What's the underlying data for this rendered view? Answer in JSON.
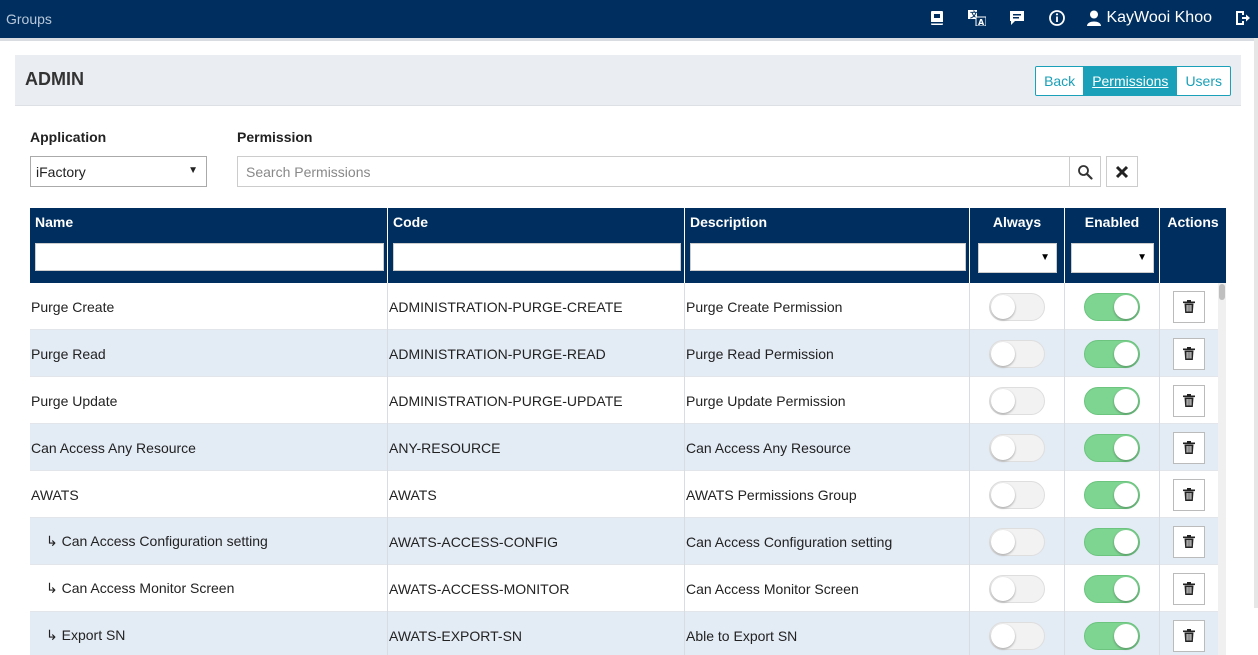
{
  "header": {
    "brand": "Groups",
    "user_name": "KayWooi Khoo",
    "icons": [
      "book-icon",
      "translate-icon",
      "message-icon",
      "info-icon",
      "user-icon",
      "logout-icon"
    ]
  },
  "panel": {
    "title": "ADMIN",
    "buttons": [
      {
        "label": "Back",
        "active": false
      },
      {
        "label": "Permissions",
        "active": true
      },
      {
        "label": "Users",
        "active": false
      }
    ]
  },
  "filters": {
    "application_label": "Application",
    "application_value": "iFactory",
    "permission_label": "Permission",
    "search_placeholder": "Search Permissions"
  },
  "table": {
    "columns": [
      "Name",
      "Code",
      "Description",
      "Always",
      "Enabled",
      "Actions"
    ],
    "rows": [
      {
        "name": "Purge Create",
        "code": "ADMINISTRATION-PURGE-CREATE",
        "description": "Purge Create Permission",
        "always": false,
        "enabled": true,
        "child": false
      },
      {
        "name": "Purge Read",
        "code": "ADMINISTRATION-PURGE-READ",
        "description": "Purge Read Permission",
        "always": false,
        "enabled": true,
        "child": false
      },
      {
        "name": "Purge Update",
        "code": "ADMINISTRATION-PURGE-UPDATE",
        "description": "Purge Update Permission",
        "always": false,
        "enabled": true,
        "child": false
      },
      {
        "name": "Can Access Any Resource",
        "code": "ANY-RESOURCE",
        "description": "Can Access Any Resource",
        "always": false,
        "enabled": true,
        "child": false
      },
      {
        "name": "AWATS",
        "code": "AWATS",
        "description": "AWATS Permissions Group",
        "always": false,
        "enabled": true,
        "child": false
      },
      {
        "name": "↳ Can Access Configuration setting",
        "code": "AWATS-ACCESS-CONFIG",
        "description": "Can Access Configuration setting",
        "always": false,
        "enabled": true,
        "child": true
      },
      {
        "name": "↳ Can Access Monitor Screen",
        "code": "AWATS-ACCESS-MONITOR",
        "description": "Can Access Monitor Screen",
        "always": false,
        "enabled": true,
        "child": true
      },
      {
        "name": "↳ Export SN",
        "code": "AWATS-EXPORT-SN",
        "description": "Able to Export SN",
        "always": false,
        "enabled": true,
        "child": true
      }
    ]
  }
}
